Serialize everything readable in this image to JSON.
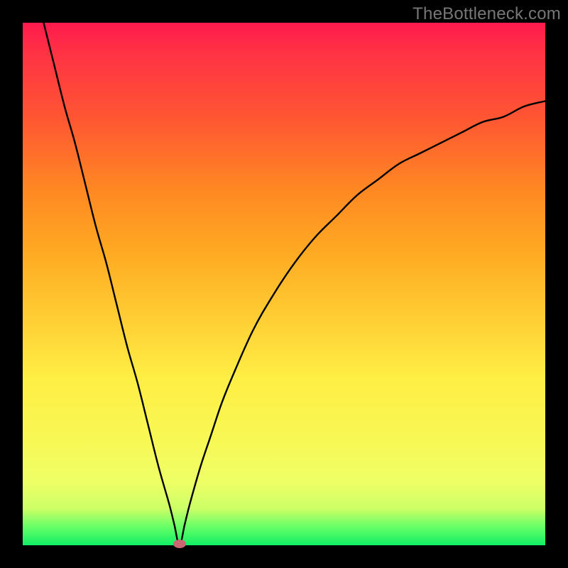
{
  "watermark": "TheBottleneck.com",
  "colors": {
    "background": "#000000",
    "curve": "#000000",
    "marker": "#cc6672",
    "gradient_top": "#ff1a4d",
    "gradient_bottom": "#11ee66"
  },
  "chart_data": {
    "type": "line",
    "title": "",
    "xlabel": "",
    "ylabel": "",
    "xlim": [
      0,
      100
    ],
    "ylim": [
      0,
      100
    ],
    "grid": false,
    "x": [
      4,
      6,
      8,
      10,
      12,
      14,
      16,
      18,
      20,
      22,
      24,
      26,
      28,
      29,
      30,
      31,
      32,
      34,
      36,
      38,
      40,
      44,
      48,
      52,
      56,
      60,
      64,
      68,
      72,
      76,
      80,
      84,
      88,
      92,
      96,
      100
    ],
    "values": [
      100,
      92,
      84,
      77,
      69,
      61,
      54,
      46,
      38,
      31,
      23,
      15,
      8,
      4,
      0,
      4,
      8,
      15,
      21,
      27,
      32,
      41,
      48,
      54,
      59,
      63,
      67,
      70,
      73,
      75,
      77,
      79,
      81,
      82,
      84,
      85
    ],
    "annotations": [
      {
        "type": "marker",
        "x": 30,
        "y": 0
      }
    ]
  }
}
